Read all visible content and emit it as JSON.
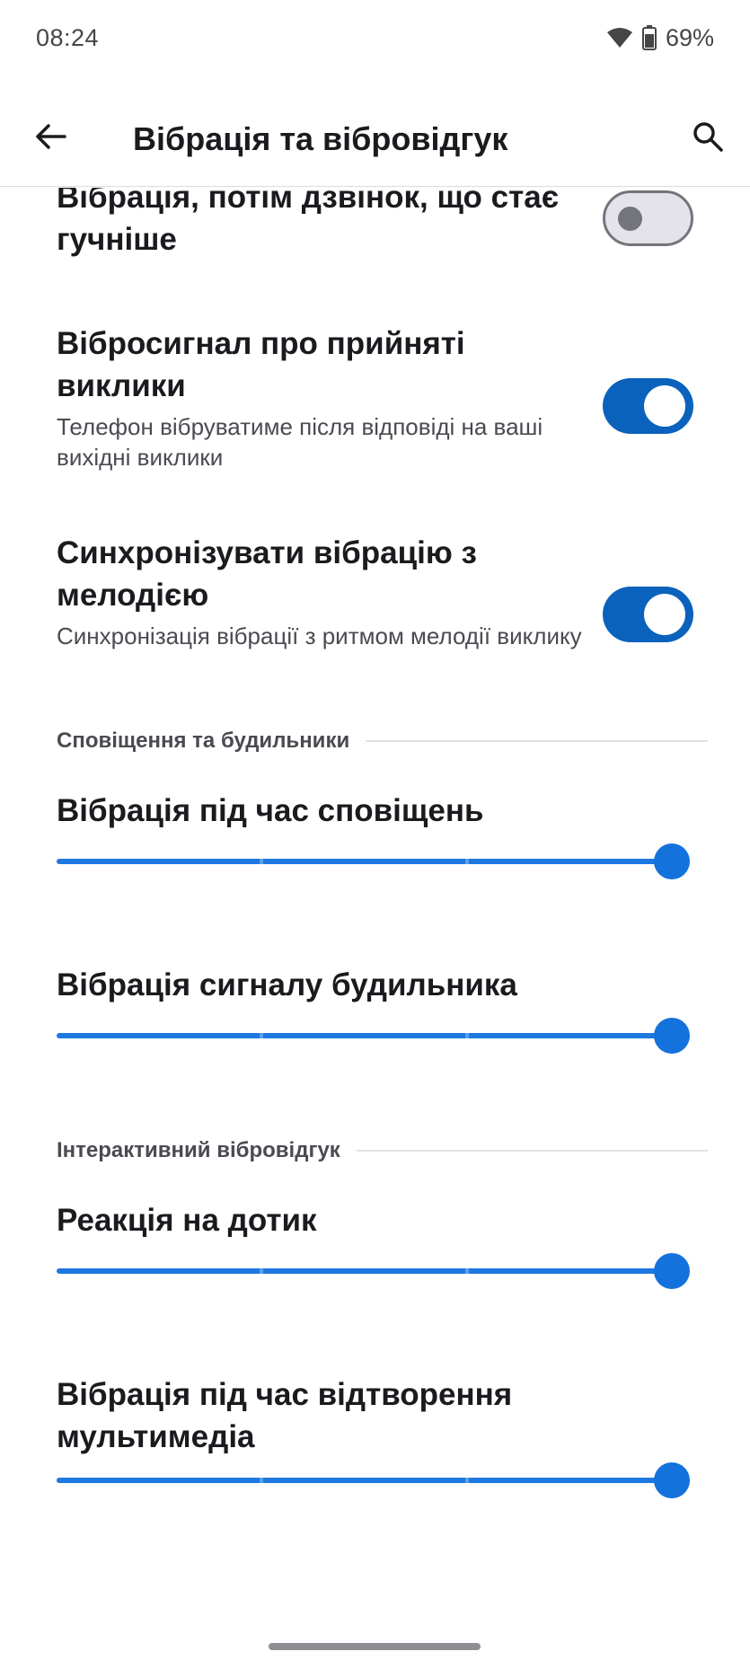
{
  "status_bar": {
    "time": "08:24",
    "battery": "69%",
    "wifi_icon": "wifi-icon",
    "battery_icon": "battery-icon"
  },
  "app_bar": {
    "title": "Вібрація та вібровідгук",
    "back_icon": "arrow-left-icon",
    "search_icon": "search-icon"
  },
  "preferences": [
    {
      "title": "Вібрація, потім дзвінок, що стає гучніше",
      "summary": "",
      "switch_on": false
    },
    {
      "title": "Вібросигнал про прийняті виклики",
      "summary": "Телефон вібруватиме після відповіді на ваші вихідні виклики",
      "switch_on": true
    },
    {
      "title": "Синхронізувати вібрацію з мелодією",
      "summary": "Синхронізація вібрації з ритмом мелодії виклику",
      "switch_on": true
    }
  ],
  "sections": {
    "notifications_alarms": "Сповіщення та будильники",
    "interactive_haptics": "Інтерактивний вібровідгук"
  },
  "sliders": [
    {
      "title": "Вібрація під час сповіщень",
      "level": 1.0
    },
    {
      "title": "Вібрація сигналу будильника",
      "level": 1.0
    },
    {
      "title": "Реакція на дотик",
      "level": 1.0
    },
    {
      "title": "Вібрація під час відтворення мультимедіа",
      "level": 1.0
    }
  ],
  "colors": {
    "accent": "#0b62bc",
    "slider": "#1d78e0",
    "switch_off_track": "#e4e3ea"
  }
}
